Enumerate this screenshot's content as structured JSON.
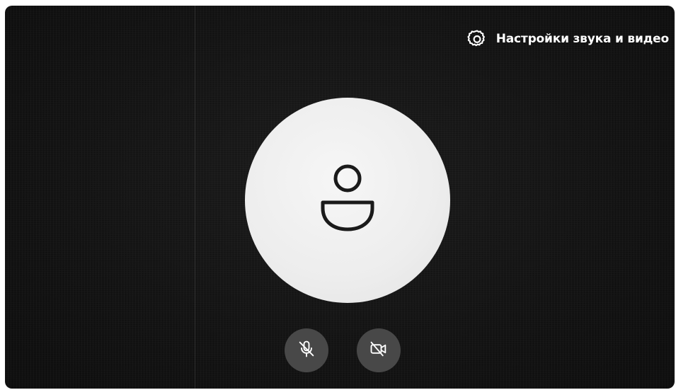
{
  "settings": {
    "label": "Настройки звука и видео",
    "icon": "gear-icon"
  },
  "avatar": {
    "icon": "user-icon"
  },
  "controls": {
    "microphone": {
      "icon": "microphone-off-icon",
      "state": "off"
    },
    "camera": {
      "icon": "camera-off-icon",
      "state": "off"
    }
  },
  "colors": {
    "background": "#151515",
    "avatar_circle": "#ededed",
    "control_button": "#484848",
    "icon_dark": "#1a1a1a",
    "text": "#ffffff"
  }
}
